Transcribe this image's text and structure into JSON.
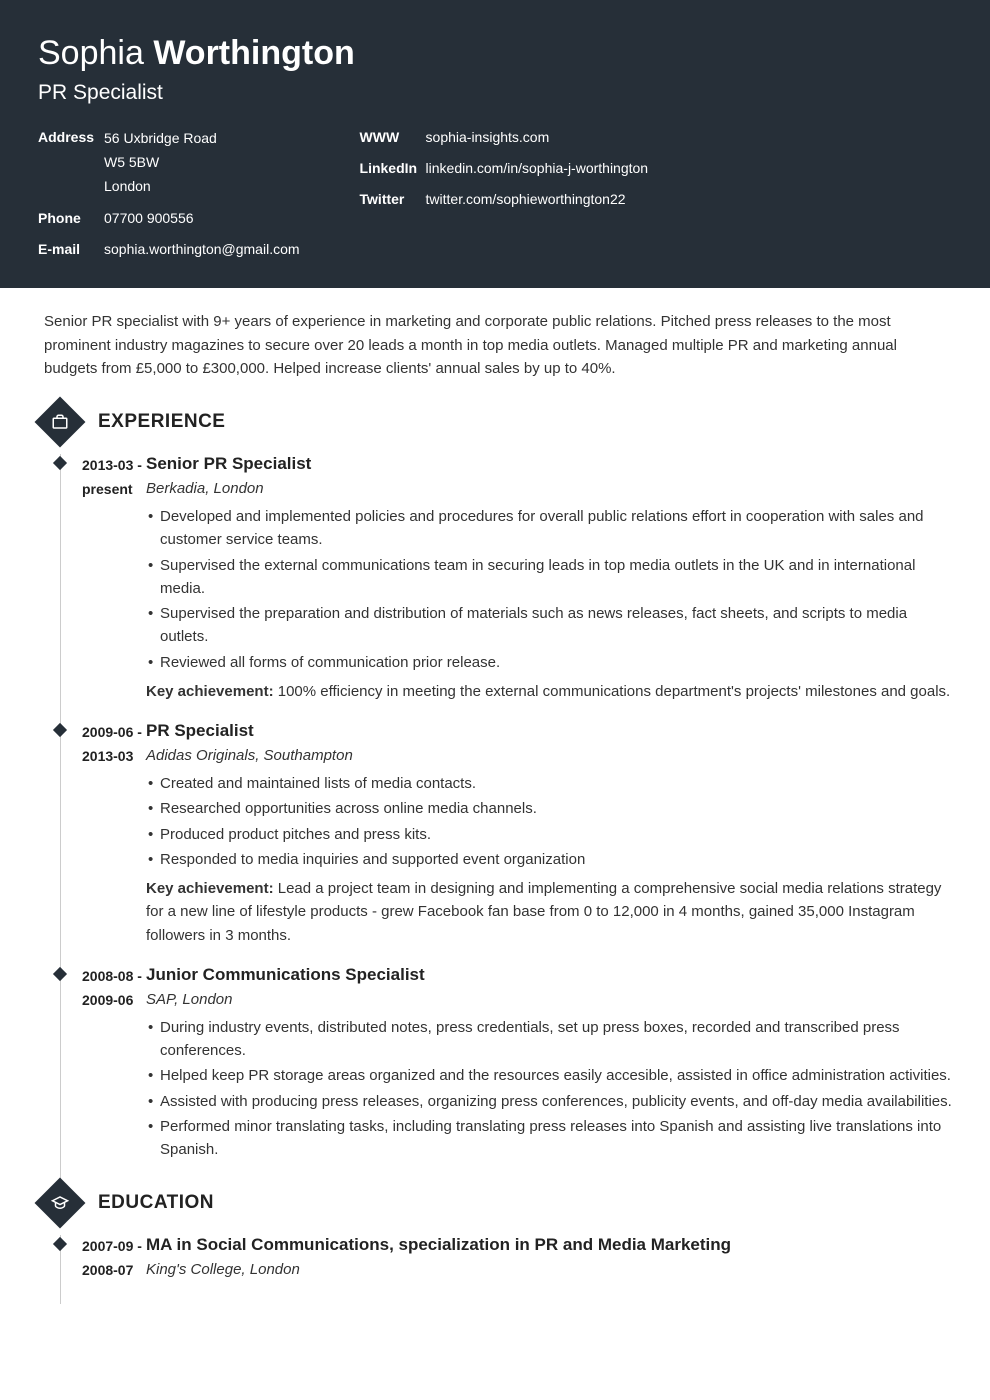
{
  "header": {
    "first_name": "Sophia",
    "last_name": "Worthington",
    "title": "PR Specialist",
    "contact_left": [
      {
        "label": "Address",
        "lines": [
          "56 Uxbridge Road",
          "W5 5BW",
          "London"
        ]
      },
      {
        "label": "Phone",
        "value": "07700 900556"
      },
      {
        "label": "E-mail",
        "value": "sophia.worthington@gmail.com"
      }
    ],
    "contact_right": [
      {
        "label": "WWW",
        "value": "sophia-insights.com"
      },
      {
        "label": "LinkedIn",
        "value": "linkedin.com/in/sophia-j-worthington"
      },
      {
        "label": "Twitter",
        "value": "twitter.com/sophieworthington22"
      }
    ]
  },
  "summary": "Senior PR specialist with 9+ years of experience in marketing and corporate public relations. Pitched press releases to the most prominent industry magazines to secure over 20 leads a month in top media outlets. Managed multiple PR and marketing annual budgets from £5,000 to £300,000. Helped increase clients' annual sales by up to 40%.",
  "sections": {
    "experience": {
      "title": "EXPERIENCE",
      "entries": [
        {
          "date": "2013-03 - present",
          "title": "Senior PR Specialist",
          "subtitle": "Berkadia, London",
          "bullets": [
            "Developed and implemented policies and procedures for overall public relations effort in cooperation with sales and customer service teams.",
            "Supervised the external communications team in securing leads in top media outlets in the UK and in international media.",
            "Supervised the preparation and distribution of materials such as news releases, fact sheets, and scripts to media outlets.",
            "Reviewed all forms of communication prior release."
          ],
          "key_label": "Key achievement:",
          "key_text": " 100% efficiency in meeting the external communications department's projects' milestones and goals."
        },
        {
          "date": "2009-06 - 2013-03",
          "title": "PR Specialist",
          "subtitle": "Adidas Originals, Southampton",
          "bullets": [
            "Created and maintained lists of media contacts.",
            "Researched opportunities across online media channels.",
            "Produced product pitches and press kits.",
            "Responded to media inquiries and supported event organization"
          ],
          "key_label": "Key achievement:",
          "key_text": " Lead a project team in designing and implementing a comprehensive social media relations strategy for a new line of lifestyle products - grew Facebook fan base from 0 to 12,000 in 4 months, gained 35,000 Instagram followers in 3 months."
        },
        {
          "date": "2008-08 - 2009-06",
          "title": "Junior Communications Specialist",
          "subtitle": "SAP, London",
          "bullets": [
            "During industry events, distributed notes, press credentials, set up press boxes, recorded and transcribed press conferences.",
            "Helped keep PR storage areas organized and the resources easily accesible, assisted in office administration activities.",
            "Assisted with producing press releases, organizing press conferences, publicity events, and off-day media availabilities.",
            "Performed minor translating tasks, including translating press releases into Spanish and assisting live translations into Spanish."
          ]
        }
      ]
    },
    "education": {
      "title": "EDUCATION",
      "entries": [
        {
          "date": "2007-09 - 2008-07",
          "title": "MA in Social Communications, specialization in PR and Media Marketing",
          "subtitle": "King's College, London"
        }
      ]
    }
  }
}
